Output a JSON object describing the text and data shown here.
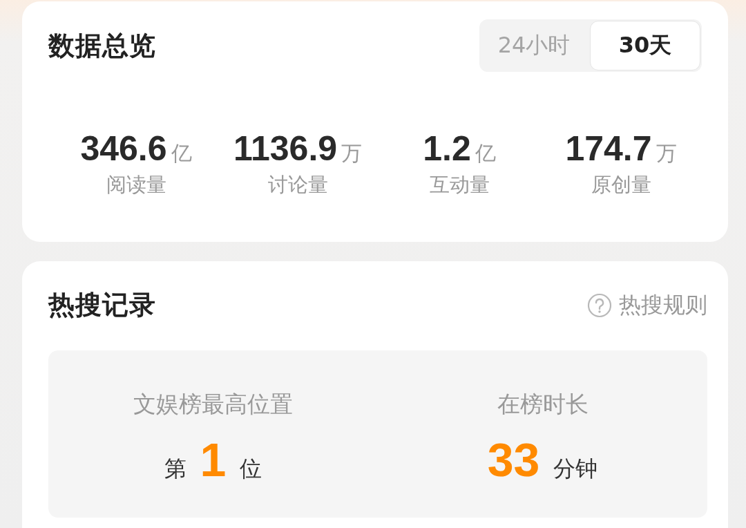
{
  "overview": {
    "title": "数据总览",
    "tabs": [
      {
        "label": "24小时",
        "selected": false
      },
      {
        "label": "30天",
        "selected": true
      }
    ],
    "stats": [
      {
        "value": "346.6",
        "unit": "亿",
        "label": "阅读量"
      },
      {
        "value": "1136.9",
        "unit": "万",
        "label": "讨论量"
      },
      {
        "value": "1.2",
        "unit": "亿",
        "label": "互动量"
      },
      {
        "value": "174.7",
        "unit": "万",
        "label": "原创量"
      }
    ]
  },
  "hot_search": {
    "title": "热搜记录",
    "rules_link": "热搜规则",
    "records": [
      {
        "label": "文娱榜最高位置",
        "prefix": "第",
        "value": "1",
        "suffix": "位"
      },
      {
        "label": "在榜时长",
        "value": "33",
        "suffix": "分钟"
      }
    ]
  }
}
